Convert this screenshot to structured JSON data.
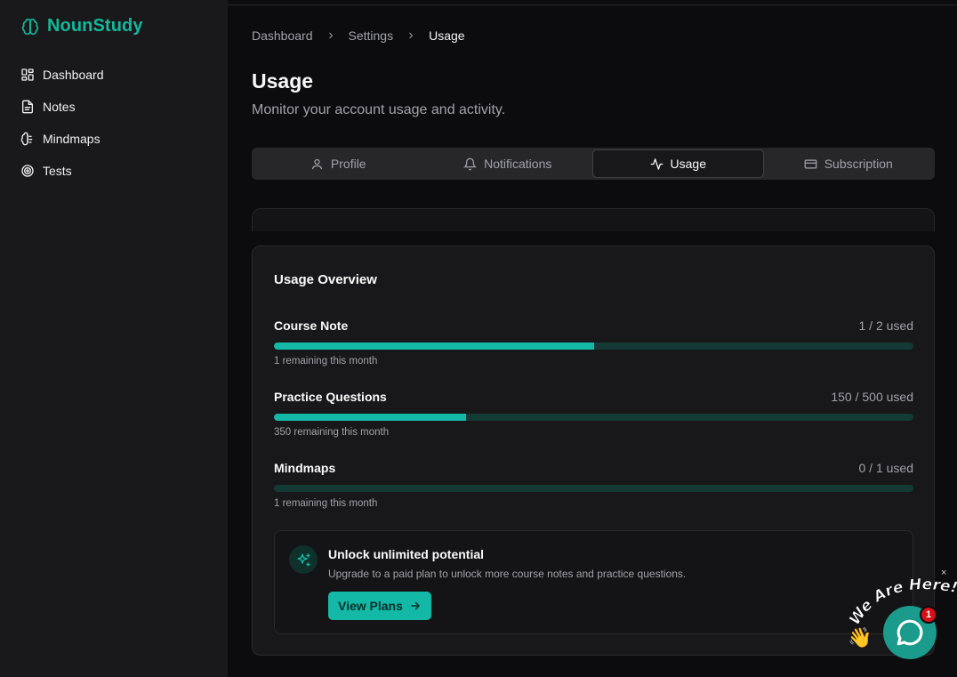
{
  "app": {
    "name": "NounStudy",
    "brand_color": "#14b89a"
  },
  "sidebar": {
    "items": [
      {
        "label": "Dashboard",
        "icon": "layout-grid-icon"
      },
      {
        "label": "Notes",
        "icon": "file-text-icon"
      },
      {
        "label": "Mindmaps",
        "icon": "brain-icon"
      },
      {
        "label": "Tests",
        "icon": "target-icon"
      }
    ]
  },
  "breadcrumb": {
    "items": [
      "Dashboard",
      "Settings",
      "Usage"
    ]
  },
  "page": {
    "title": "Usage",
    "subtitle": "Monitor your account usage and activity."
  },
  "tabs": [
    {
      "label": "Profile",
      "icon": "user-icon",
      "active": false
    },
    {
      "label": "Notifications",
      "icon": "bell-icon",
      "active": false
    },
    {
      "label": "Usage",
      "icon": "activity-icon",
      "active": true
    },
    {
      "label": "Subscription",
      "icon": "credit-card-icon",
      "active": false
    }
  ],
  "usage": {
    "title": "Usage Overview",
    "items": [
      {
        "name": "Course Note",
        "count": "1 / 2 used",
        "remaining": "1 remaining this month",
        "fraction": 0.5
      },
      {
        "name": "Practice Questions",
        "count": "150 / 500 used",
        "remaining": "350 remaining this month",
        "fraction": 0.3
      },
      {
        "name": "Mindmaps",
        "count": "0 / 1 used",
        "remaining": "1 remaining this month",
        "fraction": 0
      }
    ]
  },
  "upsell": {
    "icon": "sparkles-icon",
    "title": "Unlock unlimited potential",
    "text": "Upgrade to a paid plan to unlock more course notes and practice questions.",
    "button": "View Plans"
  },
  "chat": {
    "label": "We Are Here!",
    "badge": "1",
    "close": "×",
    "wave": "👋"
  }
}
